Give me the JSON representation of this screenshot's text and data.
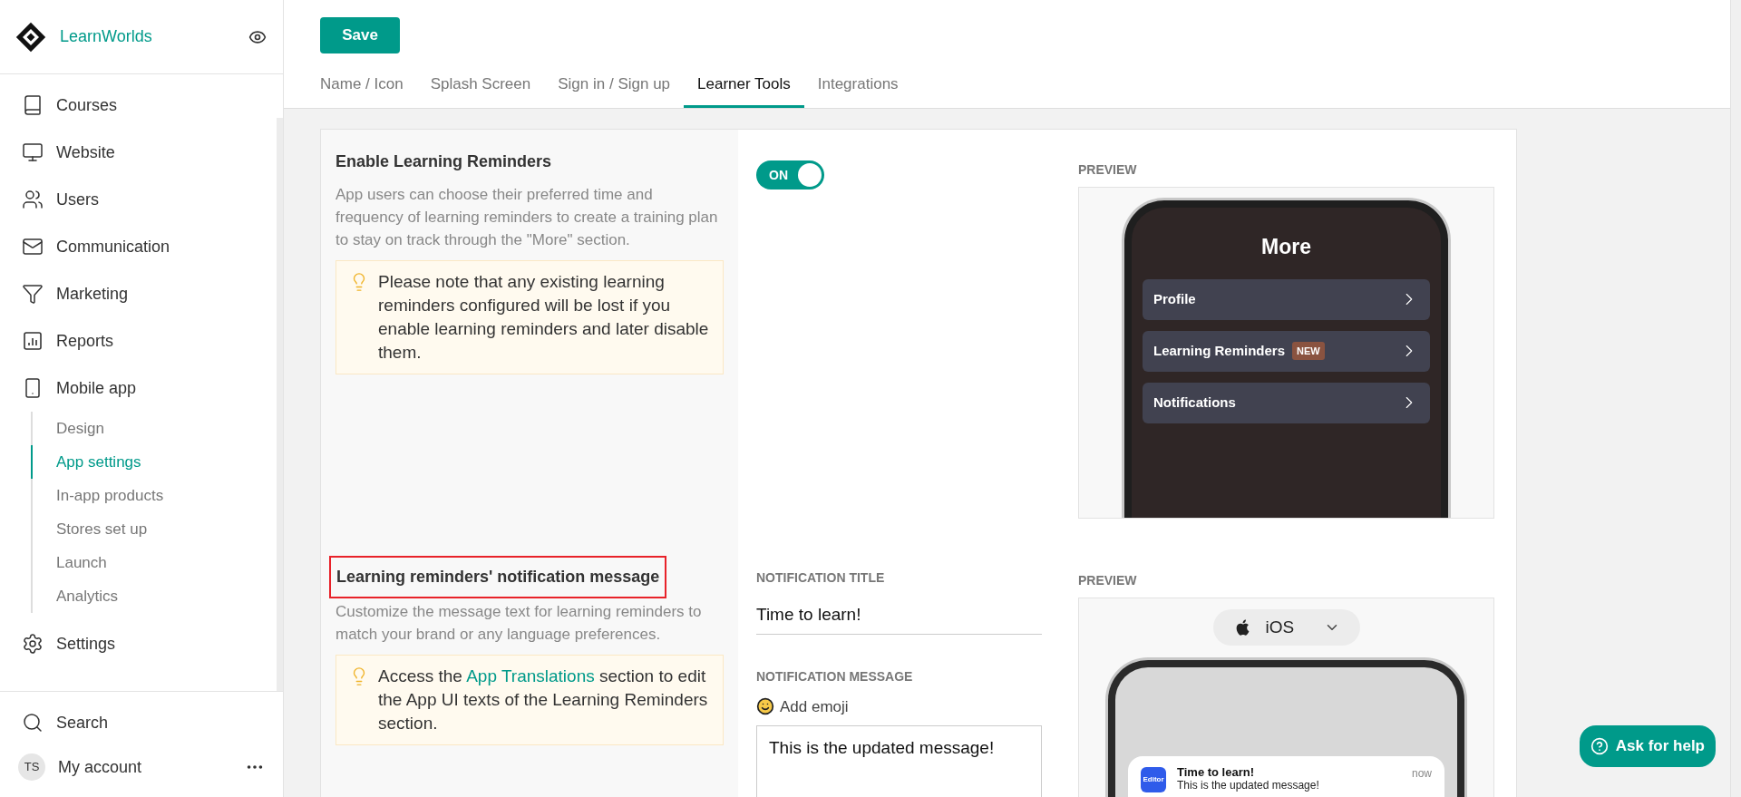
{
  "brand": {
    "name": "LearnWorlds"
  },
  "nav": [
    {
      "label": "Courses"
    },
    {
      "label": "Website"
    },
    {
      "label": "Users"
    },
    {
      "label": "Communication"
    },
    {
      "label": "Marketing"
    },
    {
      "label": "Reports"
    },
    {
      "label": "Mobile app",
      "expanded": true,
      "children": [
        {
          "label": "Design",
          "selected": false
        },
        {
          "label": "App settings",
          "selected": true
        },
        {
          "label": "In-app products",
          "selected": false
        },
        {
          "label": "Stores set up",
          "selected": false
        },
        {
          "label": "Launch",
          "selected": false
        },
        {
          "label": "Analytics",
          "selected": false
        }
      ]
    },
    {
      "label": "Settings"
    }
  ],
  "search": {
    "label": "Search"
  },
  "account": {
    "initials": "TS",
    "label": "My account"
  },
  "save_button": "Save",
  "tabs": [
    {
      "label": "Name / Icon",
      "selected": false
    },
    {
      "label": "Splash Screen",
      "selected": false
    },
    {
      "label": "Sign in / Sign up",
      "selected": false
    },
    {
      "label": "Learner Tools",
      "selected": true
    },
    {
      "label": "Integrations",
      "selected": false
    }
  ],
  "reminders": {
    "title": "Enable Learning Reminders",
    "description": "App users can choose their preferred time and frequency of learning reminders to create a training plan to stay on track through the \"More\" section.",
    "note": "Please note that any existing learning reminders configured will be lost if you enable learning reminders and later disable them.",
    "toggle": {
      "label": "ON",
      "on": true
    },
    "preview": {
      "label": "PREVIEW",
      "screen_title": "More",
      "rows": [
        {
          "label": "Profile"
        },
        {
          "label": "Learning Reminders",
          "badge": "NEW"
        },
        {
          "label": "Notifications"
        }
      ]
    }
  },
  "message": {
    "title": "Learning reminders' notification message",
    "highlighted": true,
    "description": "Customize the message text for learning reminders to match your brand or any language preferences.",
    "note_before": "Access the",
    "note_link": "App Translations",
    "note_after": "section to edit the App UI texts of the Learning Reminders section.",
    "title_label": "NOTIFICATION TITLE",
    "title_value": "Time to learn!",
    "message_label": "NOTIFICATION MESSAGE",
    "add_emoji": "Add emoji",
    "message_value": "This is the updated message!",
    "preview": {
      "label": "PREVIEW",
      "platform": "iOS",
      "notification": {
        "app": "Editor",
        "title": "Time to learn!",
        "text": "This is the updated message!",
        "time": "now"
      }
    }
  },
  "help_button": "Ask for help"
}
